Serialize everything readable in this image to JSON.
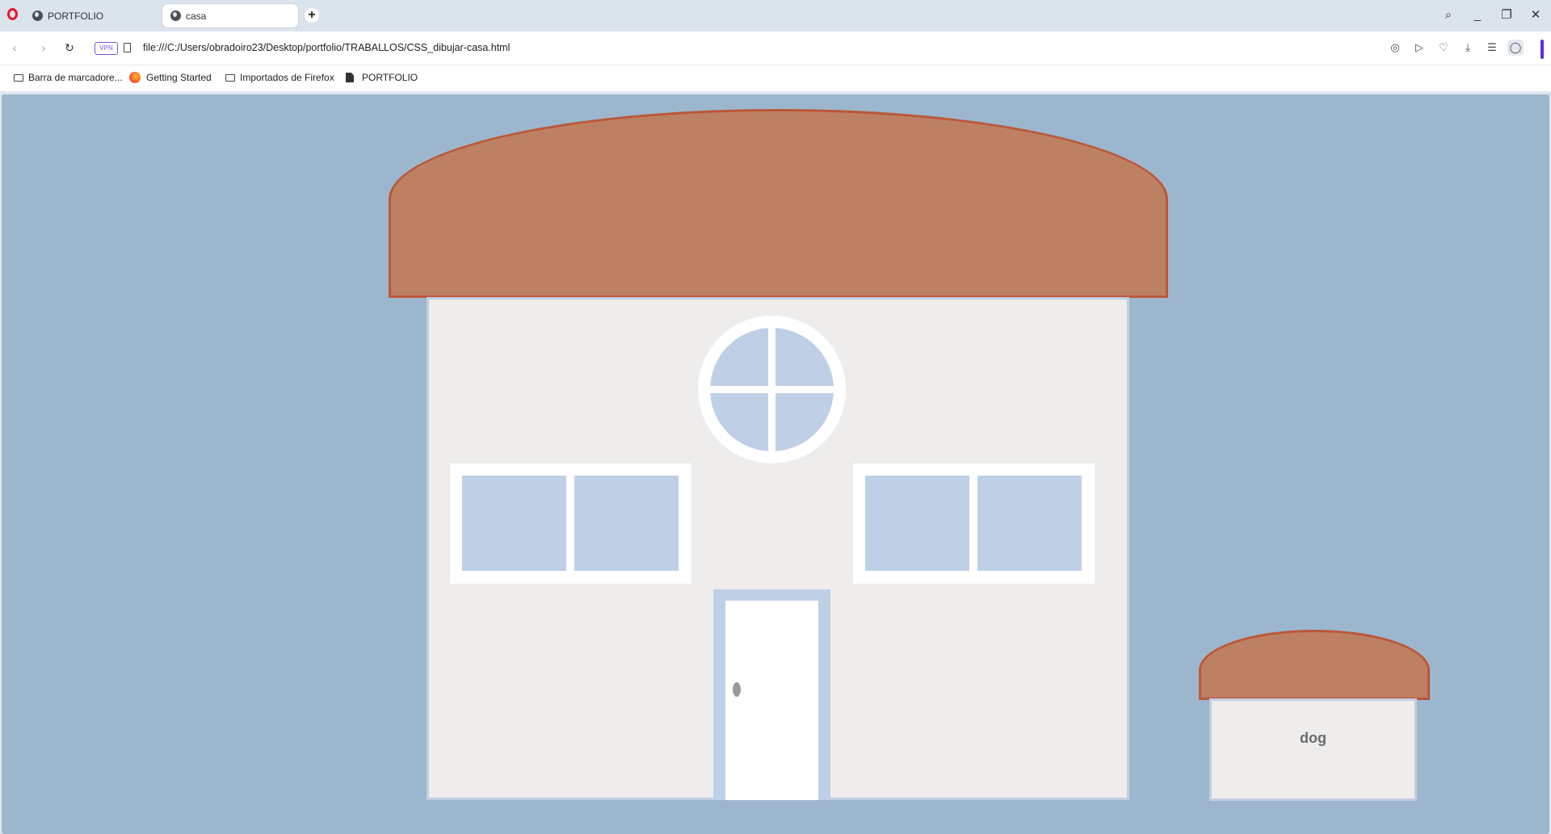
{
  "browser": {
    "tabs": [
      {
        "label": "PORTFOLIO",
        "icon": "globe-icon",
        "active": false
      },
      {
        "label": "casa",
        "icon": "globe-icon",
        "active": true
      }
    ],
    "new_tab_label": "+",
    "window_controls": {
      "search": "⌕",
      "minimize": "_",
      "restore": "❐",
      "close": "✕"
    }
  },
  "address_bar": {
    "back": "‹",
    "forward": "›",
    "reload": "↻",
    "vpn_badge": "VPN",
    "url": "file:///C:/Users/obradoiro23/Desktop/portfolio/TRABALLOS/CSS_dibujar-casa.html",
    "right_icons": [
      "camera-icon",
      "send-icon",
      "heart-icon",
      "download-icon",
      "menu-icon",
      "profile-icon"
    ]
  },
  "bookmarks": [
    {
      "label": "Barra de marcadore...",
      "icon": "folder-icon"
    },
    {
      "label": "Getting Started",
      "icon": "firefox-icon"
    },
    {
      "label": "Importados de Firefox",
      "icon": "folder-icon"
    },
    {
      "label": "PORTFOLIO",
      "icon": "document-icon"
    }
  ],
  "page": {
    "background_color": "#9cb7cd",
    "roof_color": "#bd8063",
    "wall_color": "#eeedeb",
    "glass_color": "#bfcfe6",
    "dog_label": "dog"
  }
}
